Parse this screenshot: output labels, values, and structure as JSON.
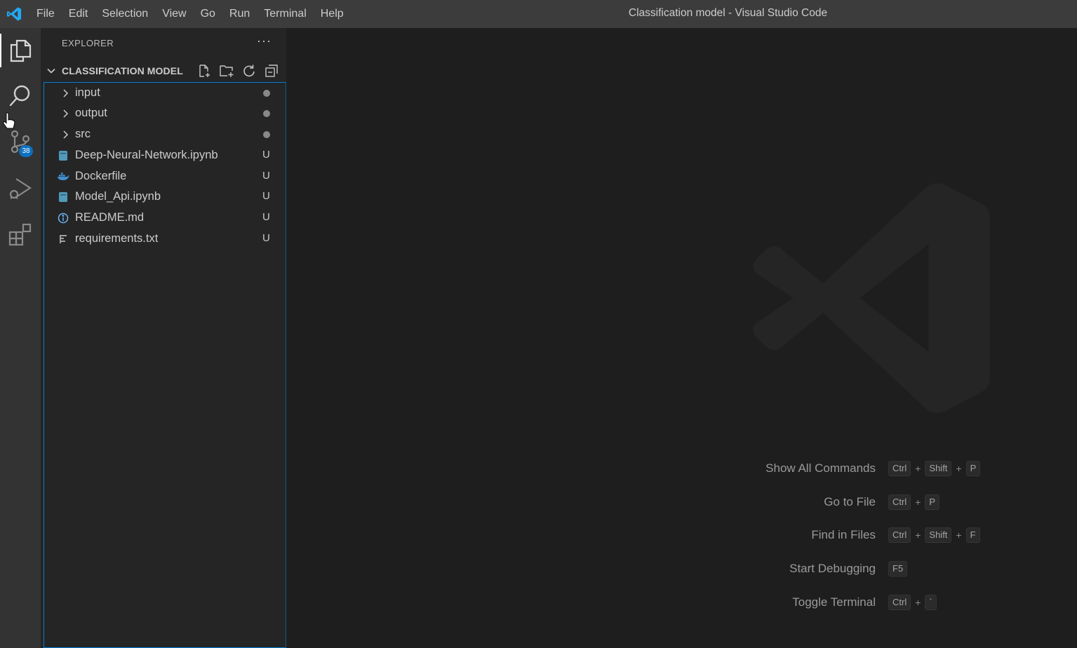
{
  "window": {
    "title": "Classification model - Visual Studio Code"
  },
  "menu": [
    "File",
    "Edit",
    "Selection",
    "View",
    "Go",
    "Run",
    "Terminal",
    "Help"
  ],
  "activity_bar": {
    "items": [
      {
        "icon": "files-icon",
        "active": true
      },
      {
        "icon": "search-icon"
      },
      {
        "icon": "source-control-icon",
        "badge": "38"
      },
      {
        "icon": "run-debug-icon"
      },
      {
        "icon": "extensions-icon"
      }
    ]
  },
  "sidebar": {
    "header": "EXPLORER",
    "more": "···",
    "folder": {
      "title": "CLASSIFICATION MODEL",
      "actions": [
        "new-file-icon",
        "new-folder-icon",
        "refresh-icon",
        "collapse-all-icon"
      ]
    },
    "items": [
      {
        "type": "folder",
        "label": "input",
        "status": ""
      },
      {
        "type": "folder",
        "label": "output",
        "status": ""
      },
      {
        "type": "folder",
        "label": "src",
        "status": ""
      },
      {
        "type": "notebook",
        "label": "Deep-Neural-Network.ipynb",
        "status": "U"
      },
      {
        "type": "docker",
        "label": "Dockerfile",
        "status": "U"
      },
      {
        "type": "notebook",
        "label": "Model_Api.ipynb",
        "status": "U"
      },
      {
        "type": "info",
        "label": "README.md",
        "status": "U"
      },
      {
        "type": "text",
        "label": "requirements.txt",
        "status": "U"
      }
    ]
  },
  "editor": {
    "shortcuts": [
      {
        "label": "Show All Commands",
        "keys": [
          "Ctrl",
          "Shift",
          "P"
        ]
      },
      {
        "label": "Go to File",
        "keys": [
          "Ctrl",
          "P"
        ]
      },
      {
        "label": "Find in Files",
        "keys": [
          "Ctrl",
          "Shift",
          "F"
        ]
      },
      {
        "label": "Start Debugging",
        "keys": [
          "F5"
        ]
      },
      {
        "label": "Toggle Terminal",
        "keys": [
          "Ctrl",
          "`"
        ]
      }
    ]
  },
  "colors": {
    "accent": "#007fd4",
    "badge": "#0e70c0",
    "notebook": "#519aba",
    "docker": "#3f8fd0",
    "info": "#6cb5f0"
  }
}
